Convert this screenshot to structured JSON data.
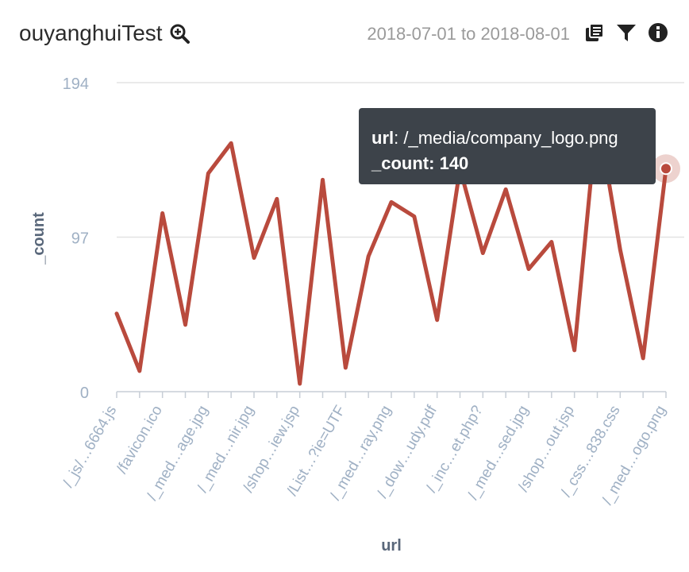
{
  "header": {
    "title": "ouyanghuiTest",
    "date_range": "2018-07-01 to 2018-08-01",
    "icons": [
      "zoom-in-icon",
      "copy-icon",
      "filter-icon",
      "info-icon"
    ]
  },
  "tooltip": {
    "key1": "url",
    "value1": "/_media/company_logo.png",
    "key2": "_count",
    "value2": "140"
  },
  "colors": {
    "line": "#b94a3d",
    "axis_text": "#9fb0c4",
    "axis_title": "#59677a",
    "grid": "#e3e3e3"
  },
  "chart_data": {
    "type": "line",
    "xlabel": "url",
    "ylabel": "_count",
    "ylim": [
      0,
      194
    ],
    "yticks": [
      0,
      97,
      194
    ],
    "tick_labels": [
      "/_js/…6664.js",
      "/favicon.ico",
      "/_med…age.jpg",
      "/_med…nir.jpg",
      "/shop…iew.jsp",
      "/List…?ie=UTF",
      "/_med…ray.png",
      "/_dow…udy.pdf",
      "/_inc…et.php?",
      "/_med…sed.jpg",
      "/shop…out.jsp",
      "/_css…838.css",
      "/_med…ogo.png"
    ],
    "x_index": [
      0,
      1,
      2,
      3,
      4,
      5,
      6,
      7,
      8,
      9,
      10,
      11,
      12,
      13,
      14,
      15,
      16,
      17,
      18,
      19,
      20,
      21,
      22,
      23,
      24
    ],
    "values": [
      49,
      13,
      112,
      42,
      137,
      156,
      84,
      121,
      5,
      133,
      15,
      85,
      119,
      110,
      45,
      140,
      87,
      127,
      77,
      94,
      26,
      175,
      89,
      21,
      140
    ],
    "highlight_index": 24
  }
}
